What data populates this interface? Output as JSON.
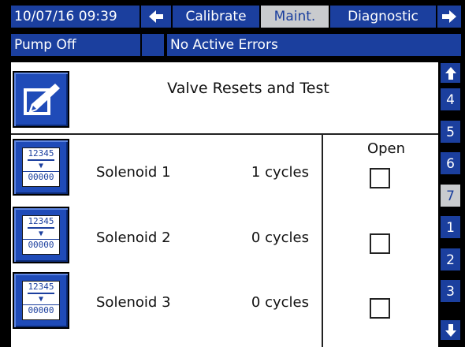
{
  "header": {
    "datetime": "10/07/16 09:39",
    "tabs": [
      {
        "label": "Calibrate",
        "active": false
      },
      {
        "label": "Maint.",
        "active": true
      },
      {
        "label": "Diagnostic",
        "active": false
      }
    ]
  },
  "status": {
    "pump": "Pump Off",
    "errors": "No Active Errors"
  },
  "screen": {
    "title": "Valve Resets and Test",
    "open_header": "Open"
  },
  "rows": [
    {
      "name": "Solenoid 1",
      "cycles": "1 cycles",
      "open": false,
      "counter_top": "12345",
      "counter_bottom": "00000"
    },
    {
      "name": "Solenoid 2",
      "cycles": "0 cycles",
      "open": false,
      "counter_top": "12345",
      "counter_bottom": "00000"
    },
    {
      "name": "Solenoid 3",
      "cycles": "0 cycles",
      "open": false,
      "counter_top": "12345",
      "counter_bottom": "00000"
    }
  ],
  "sidebar": {
    "pages": [
      "4",
      "5",
      "6",
      "7",
      "1",
      "2",
      "3"
    ],
    "active_page": "7"
  },
  "icons": {
    "nav_left": "left-arrow-icon",
    "nav_right": "right-arrow-icon",
    "scroll_up": "up-arrow-icon",
    "scroll_down": "down-arrow-icon",
    "edit": "edit-pencil-icon",
    "reset": "counter-reset-icon"
  },
  "colors": {
    "accent": "#1b3f9e",
    "active_tab": "#c9cbce"
  }
}
